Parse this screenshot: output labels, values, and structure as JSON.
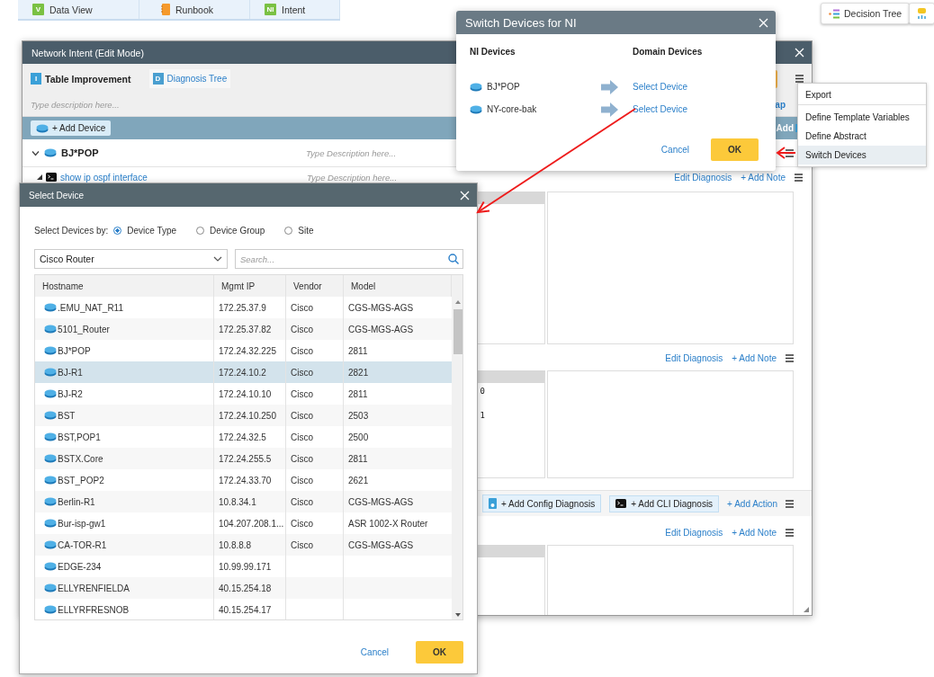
{
  "top_tabs": [
    {
      "kind": "letter",
      "badge": "V",
      "label": "Data View"
    },
    {
      "kind": "notebook",
      "label": "Runbook"
    },
    {
      "kind": "letter",
      "badge": "NI",
      "label": "Intent"
    }
  ],
  "toolbar_buttons": [
    {
      "kind": "tree",
      "label": "Decision Tree"
    },
    {
      "kind": "trophy"
    }
  ],
  "intent_window": {
    "title": "Network Intent (Edit Mode)",
    "intent": {
      "badge": "I",
      "name": "Table Improvement"
    },
    "view_tab": {
      "badge": "D",
      "label": "Diagnosis Tree"
    },
    "description_placeholder": "Type description here...",
    "map_fragment": "ap",
    "add_device_button": "+ Add Device",
    "add_fragment": "Add",
    "device": {
      "name": "BJ*POP",
      "expanded": true,
      "description_placeholder": "Type Description here..."
    },
    "command": {
      "name": "show ip ospf interface",
      "expanded": true,
      "description_placeholder": "Type Description here..."
    },
    "diagnoses": [
      {
        "edit": "Edit Diagnosis",
        "note": "+ Add Note"
      },
      {
        "edit": "Edit Diagnosis",
        "note": "+ Add Note",
        "output": [
          "0",
          "1"
        ]
      },
      {
        "edit": "Edit Diagnosis",
        "note": "+ Add Note"
      }
    ],
    "add_bar": {
      "config": "+ Add Config Diagnosis",
      "cli": "+ Add CLI Diagnosis",
      "action": "+ Add Action"
    }
  },
  "menu": [
    {
      "label": "Export",
      "selected": false,
      "divider_below": true
    },
    {
      "label": "Define Template Variables",
      "selected": false,
      "divider_below": false
    },
    {
      "label": "Define Abstract",
      "selected": false,
      "divider_below": false
    },
    {
      "label": "Switch Devices",
      "selected": true,
      "divider_below": false
    }
  ],
  "switch_dialog": {
    "title": "Switch Devices for NI",
    "headings": [
      "NI Devices",
      "Domain Devices"
    ],
    "rows": [
      {
        "ni_device": "BJ*POP",
        "domain_device": "Select Device"
      },
      {
        "ni_device": "NY-core-bak",
        "domain_device": "Select Device"
      }
    ],
    "cancel": "Cancel",
    "ok": "OK"
  },
  "select_dialog": {
    "title": "Select Device",
    "by_label": "Select Devices by:",
    "options": [
      {
        "label": "Device Type",
        "selected": true
      },
      {
        "label": "Device Group",
        "selected": false
      },
      {
        "label": "Site",
        "selected": false
      }
    ],
    "type_value": "Cisco Router",
    "search_placeholder": "Search...",
    "columns": [
      "Hostname",
      "Mgmt IP",
      "Vendor",
      "Model"
    ],
    "rows": [
      {
        "hostname": ".EMU_NAT_R11",
        "ip": "172.25.37.9",
        "vendor": "Cisco",
        "model": "CGS-MGS-AGS",
        "selected": false
      },
      {
        "hostname": "5101_Router",
        "ip": "172.25.37.82",
        "vendor": "Cisco",
        "model": "CGS-MGS-AGS",
        "selected": false
      },
      {
        "hostname": "BJ*POP",
        "ip": "172.24.32.225",
        "vendor": "Cisco",
        "model": "2811",
        "selected": false
      },
      {
        "hostname": "BJ-R1",
        "ip": "172.24.10.2",
        "vendor": "Cisco",
        "model": "2821",
        "selected": true
      },
      {
        "hostname": "BJ-R2",
        "ip": "172.24.10.10",
        "vendor": "Cisco",
        "model": "2811",
        "selected": false
      },
      {
        "hostname": "BST",
        "ip": "172.24.10.250",
        "vendor": "Cisco",
        "model": "2503",
        "selected": false
      },
      {
        "hostname": "BST,POP1",
        "ip": "172.24.32.5",
        "vendor": "Cisco",
        "model": "2500",
        "selected": false
      },
      {
        "hostname": "BSTX.Core",
        "ip": "172.24.255.5",
        "vendor": "Cisco",
        "model": "2811",
        "selected": false
      },
      {
        "hostname": "BST_POP2",
        "ip": "172.24.33.70",
        "vendor": "Cisco",
        "model": "2621",
        "selected": false
      },
      {
        "hostname": "Berlin-R1",
        "ip": "10.8.34.1",
        "vendor": "Cisco",
        "model": "CGS-MGS-AGS",
        "selected": false
      },
      {
        "hostname": "Bur-isp-gw1",
        "ip": "104.207.208.1...",
        "vendor": "Cisco",
        "model": "ASR 1002-X Router",
        "selected": false
      },
      {
        "hostname": "CA-TOR-R1",
        "ip": "10.8.8.8",
        "vendor": "Cisco",
        "model": "CGS-MGS-AGS",
        "selected": false
      },
      {
        "hostname": "EDGE-234",
        "ip": "10.99.99.171",
        "selected": false
      },
      {
        "hostname": "ELLYRENFIELDA",
        "ip": "40.15.254.18",
        "selected": false
      },
      {
        "hostname": "ELLYRFRESNOB",
        "ip": "40.15.254.17",
        "selected": false
      }
    ],
    "cancel": "Cancel",
    "ok": "OK"
  }
}
